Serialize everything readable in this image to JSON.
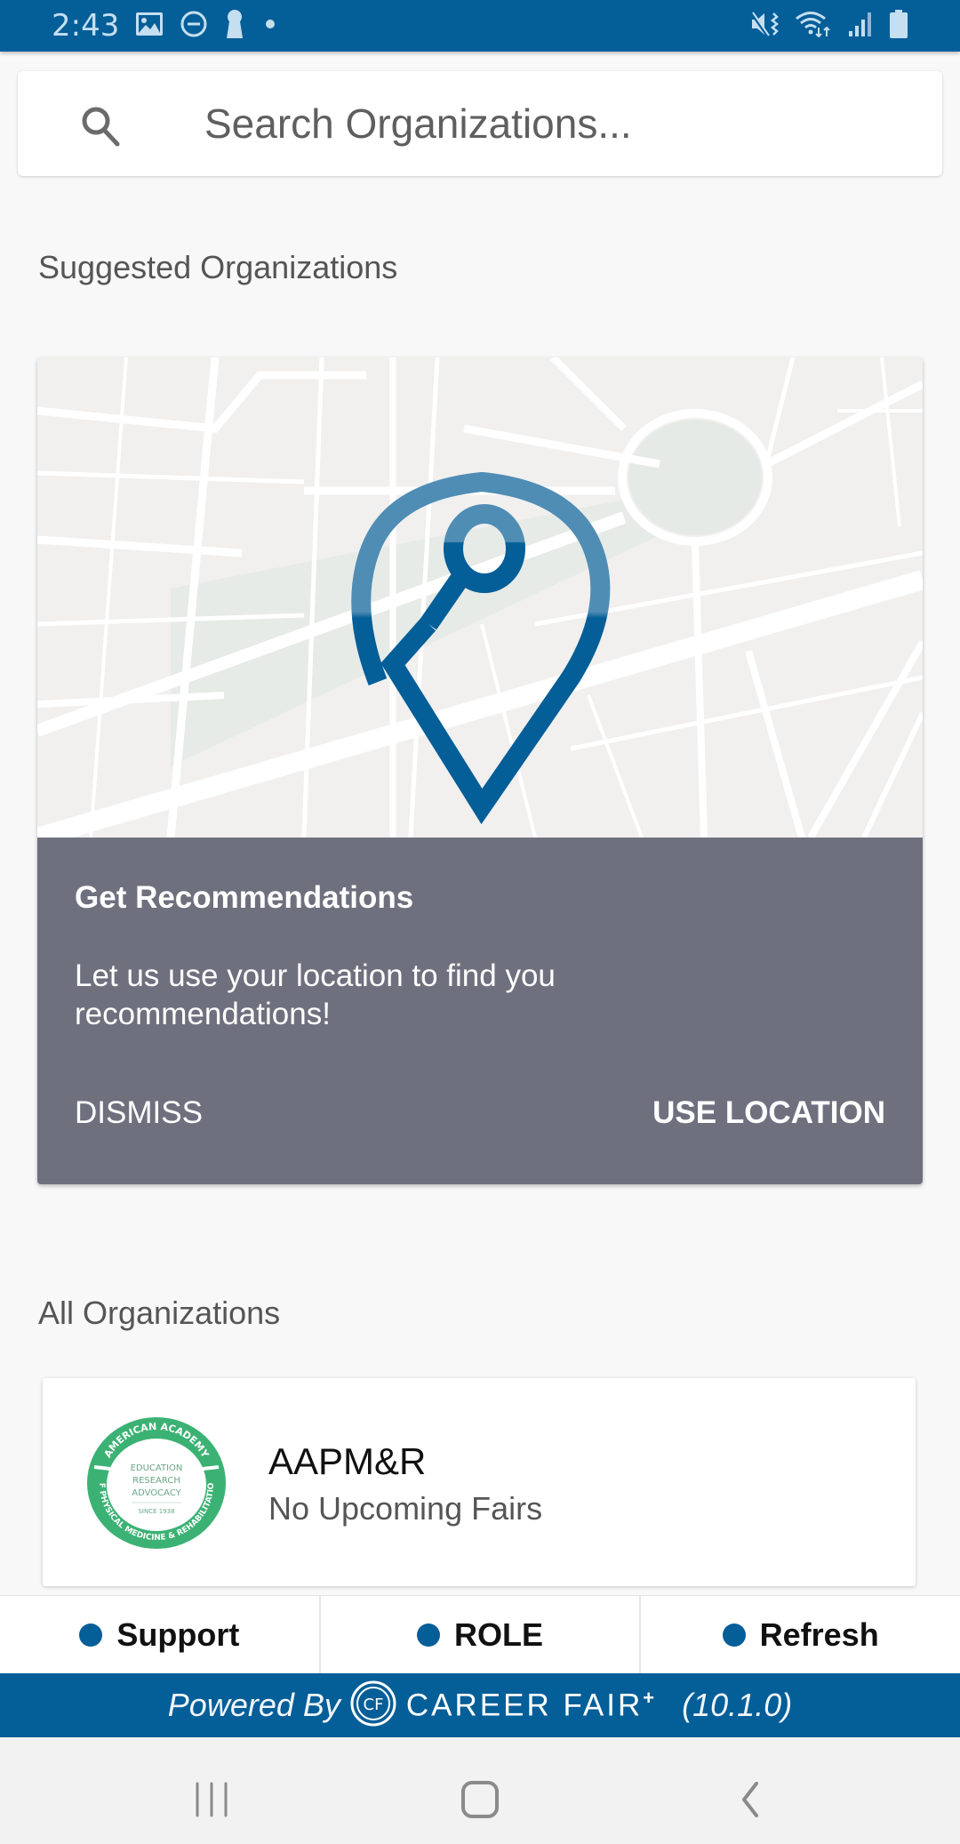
{
  "status_bar": {
    "time": "2:43",
    "left_icons": [
      "gallery-icon",
      "do-not-disturb-icon",
      "keyhole-icon",
      "dot-icon"
    ],
    "right_icons": [
      "mute-vibrate-icon",
      "wifi-data-icon",
      "signal-icon",
      "battery-icon"
    ]
  },
  "search": {
    "placeholder": "Search Organizations...",
    "value": ""
  },
  "suggested": {
    "title": "Suggested Organizations",
    "card": {
      "title": "Get Recommendations",
      "body": "Let us use your location to find you recommendations!",
      "dismiss_label": "DISMISS",
      "use_location_label": "USE LOCATION"
    }
  },
  "all_orgs": {
    "title": "All Organizations",
    "items": [
      {
        "name": "AAPM&R",
        "subtitle": "No Upcoming Fairs",
        "logo": {
          "ring_top": "AMERICAN ACADEMY",
          "ring_bottom": "OF PHYSICAL MEDICINE & REHABILITATION",
          "lines": [
            "EDUCATION",
            "RESEARCH",
            "ADVOCACY"
          ],
          "since": "SINCE 1938"
        }
      }
    ]
  },
  "bottom_tabs": [
    {
      "label": "Support"
    },
    {
      "label": "ROLE"
    },
    {
      "label": "Refresh"
    }
  ],
  "footer": {
    "powered_by": "Powered By",
    "logo_mark": "CF",
    "brand": "CAREER FAIR",
    "brand_sup": "+",
    "version": "(10.1.0)"
  },
  "colors": {
    "brand_blue": "#045e98",
    "panel_gray": "#6f707e",
    "logo_green": "#3bb273"
  }
}
